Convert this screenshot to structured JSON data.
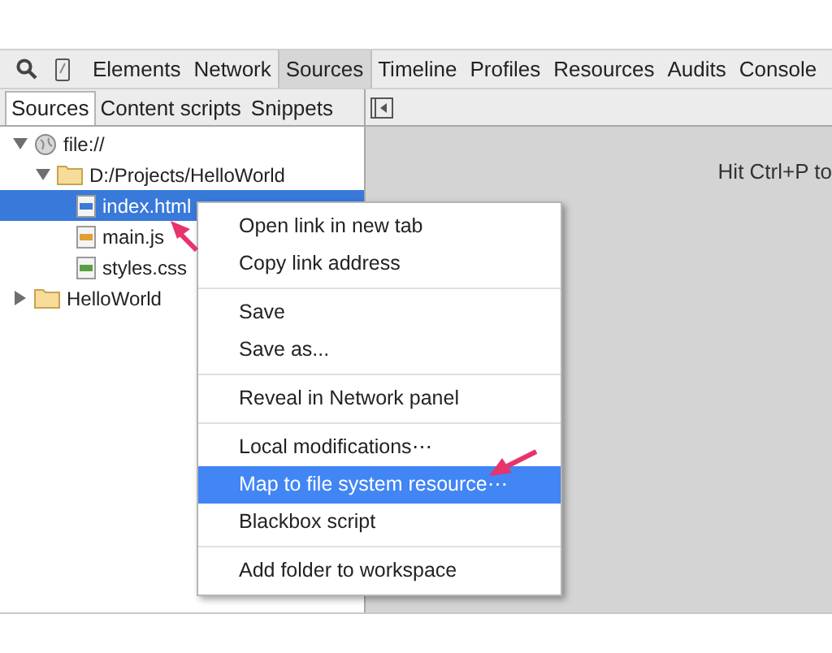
{
  "toolbar": {
    "tabs": [
      {
        "label": "Elements",
        "selected": false
      },
      {
        "label": "Network",
        "selected": false
      },
      {
        "label": "Sources",
        "selected": true
      },
      {
        "label": "Timeline",
        "selected": false
      },
      {
        "label": "Profiles",
        "selected": false
      },
      {
        "label": "Resources",
        "selected": false
      },
      {
        "label": "Audits",
        "selected": false
      },
      {
        "label": "Console",
        "selected": false
      }
    ]
  },
  "navigator": {
    "tabs": [
      {
        "label": "Sources",
        "selected": true
      },
      {
        "label": "Content scripts",
        "selected": false
      },
      {
        "label": "Snippets",
        "selected": false
      }
    ],
    "tree": [
      {
        "label": "file://",
        "kind": "origin",
        "expanded": true,
        "selected": false,
        "children": [
          {
            "label": "D:/Projects/HelloWorld",
            "kind": "folder",
            "expanded": true,
            "selected": false,
            "children": [
              {
                "label": "index.html",
                "kind": "html",
                "selected": true
              },
              {
                "label": "main.js",
                "kind": "js",
                "selected": false
              },
              {
                "label": "styles.css",
                "kind": "css",
                "selected": false
              }
            ]
          }
        ]
      },
      {
        "label": "HelloWorld",
        "kind": "folder",
        "expanded": false,
        "selected": false
      }
    ]
  },
  "editor": {
    "hint": "Hit Ctrl+P to"
  },
  "context_menu": {
    "groups": [
      [
        {
          "label": "Open link in new tab",
          "selected": false
        },
        {
          "label": "Copy link address",
          "selected": false
        }
      ],
      [
        {
          "label": "Save",
          "selected": false
        },
        {
          "label": "Save as...",
          "selected": false
        }
      ],
      [
        {
          "label": "Reveal in Network panel",
          "selected": false
        }
      ],
      [
        {
          "label": "Local modifications⋯",
          "selected": false
        },
        {
          "label": "Map to file system resource⋯",
          "selected": true
        },
        {
          "label": "Blackbox script",
          "selected": false
        }
      ],
      [
        {
          "label": "Add folder to workspace",
          "selected": false
        }
      ]
    ]
  }
}
